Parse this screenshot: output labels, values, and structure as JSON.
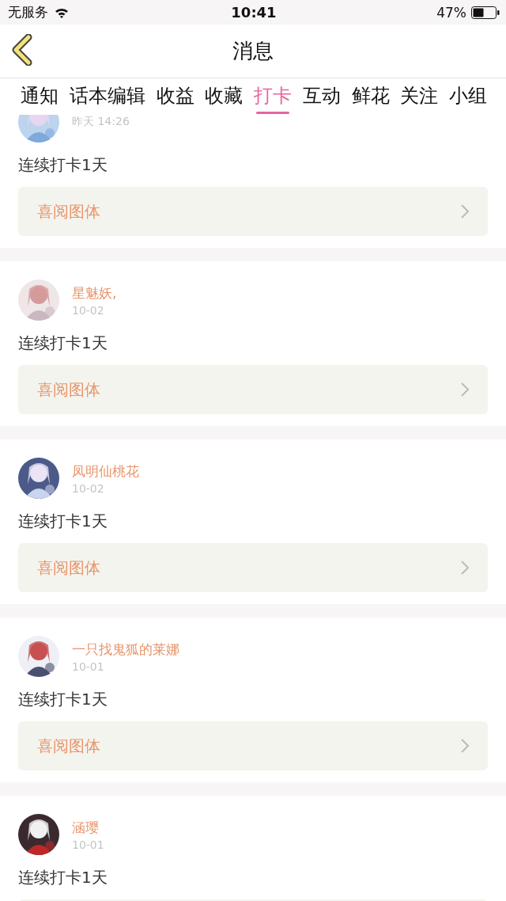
{
  "status_bar": {
    "carrier": "无服务",
    "time": "10:41",
    "battery": "47%"
  },
  "nav": {
    "title": "消息"
  },
  "tabs": [
    {
      "label": "通知",
      "selected": false
    },
    {
      "label": "话本编辑",
      "selected": false
    },
    {
      "label": "收益",
      "selected": false
    },
    {
      "label": "收藏",
      "selected": false
    },
    {
      "label": "打卡",
      "selected": true
    },
    {
      "label": "互动",
      "selected": false
    },
    {
      "label": "鲜花",
      "selected": false
    },
    {
      "label": "关注",
      "selected": false
    },
    {
      "label": "小组",
      "selected": false
    }
  ],
  "messages": [
    {
      "date": "昨天 14:26",
      "text": "连续打卡1天",
      "link": "喜阅图体"
    },
    {
      "name": "星魅妖,",
      "date": "10-02",
      "text": "连续打卡1天",
      "link": "喜阅图体"
    },
    {
      "name": "凤明仙桃花",
      "date": "10-02",
      "text": "连续打卡1天",
      "link": "喜阅图体"
    },
    {
      "name": "一只找鬼狐的莱娜",
      "date": "10-01",
      "text": "连续打卡1天",
      "link": "喜阅图体"
    },
    {
      "name": "涵璎",
      "date": "10-01",
      "text": "连续打卡1天"
    }
  ]
}
